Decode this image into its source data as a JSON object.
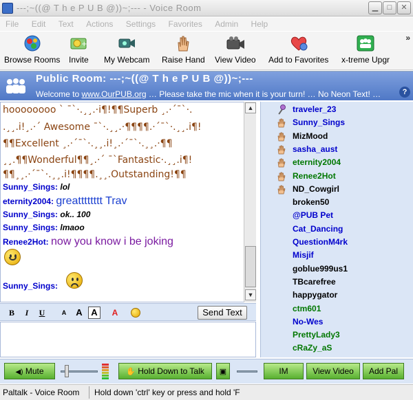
{
  "window": {
    "title": "---;~((@  T h e  P U B  @))~;--- - Voice Room"
  },
  "menu": [
    "File",
    "Edit",
    "Text",
    "Actions",
    "Settings",
    "Favorites",
    "Admin",
    "Help"
  ],
  "toolbar": {
    "items": [
      {
        "label": "Browse Rooms",
        "icon": "globe-icon"
      },
      {
        "label": "Invite",
        "icon": "invite-icon"
      },
      {
        "label": "My Webcam",
        "icon": "webcam-icon"
      },
      {
        "label": "Raise Hand",
        "icon": "hand-icon"
      },
      {
        "label": "View Video",
        "icon": "video-camera-icon"
      },
      {
        "label": "Add to Favorites",
        "icon": "heart-icon"
      },
      {
        "label": "x-treme Upgr",
        "icon": "group-icon"
      }
    ],
    "more": "»"
  },
  "room": {
    "title_prefix": "Public Room:",
    "title": "---;~((@  T h e  P U B  @))~;---",
    "welcome_prefix": "Welcome to",
    "welcome_link": "www.OurPUB.org",
    "welcome_rest": "… Please take the mic when it is your turn! … No Neon Text! …"
  },
  "chat": {
    "art_lines": [
      {
        "text": "hoooooooo ` ¯`·.¸¸.·i¶!¶¶Superb ¸.·´¯`·.",
        "color": "#8b4513"
      },
      {
        "text": ".¸¸.i!¸.·´ Awesome ¯`·.¸¸.·¶¶¶¶.·´¯`·.¸¸.i¶!",
        "color": "#8b4513"
      },
      {
        "text": "¶¶Excellent ¸.·´¯`·.¸¸.i!¸.·´¯`·.¸¸.·¶¶",
        "color": "#8b4513"
      },
      {
        "text": "¸¸.¶¶Wonderful¶¶¸.·´ ¯`Fantastic·.¸¸.i¶!",
        "color": "#8b4513"
      },
      {
        "text": "¶¶¸¸.·´¯`·.¸¸.i!¶¶¶¶.¸¸.Outstanding!¶¶",
        "color": "#8b4513"
      }
    ],
    "messages": [
      {
        "nick": "Sunny_Sings:",
        "text": "lol",
        "style": "italic",
        "color": "#000000"
      },
      {
        "nick": "eternity2004:",
        "text": "greatttttttt Trav",
        "style": "large",
        "color": "#1a3fd0"
      },
      {
        "nick": "Sunny_Sings:",
        "text": "ok.. 100",
        "style": "italic",
        "color": "#000000"
      },
      {
        "nick": "Sunny_Sings:",
        "text": "lmaoo",
        "style": "italic",
        "color": "#000000"
      },
      {
        "nick": "Renee2Hot:",
        "text": "now you know i be joking",
        "style": "large",
        "color": "#7a1aa0"
      },
      {
        "nick": "Sunny_Sings:",
        "text": "",
        "style": "emote",
        "color": "#000000"
      }
    ]
  },
  "format_bar": {
    "bold": "B",
    "italic": "I",
    "underline": "U",
    "font_small": "A",
    "font_large": "A",
    "font_normal": "A",
    "font_color": "A",
    "send_label": "Send Text"
  },
  "bottom": {
    "mute_label": "Mute",
    "talk_label": "Hold Down to Talk",
    "im_label": "IM",
    "view_video_label": "View Video",
    "add_pal_label": "Add Pal"
  },
  "status": {
    "app": "Paltalk - Voice Room",
    "hint": "Hold down 'ctrl' key or press and hold 'F"
  },
  "users": [
    {
      "name": "traveler_23",
      "color": "#0000cc",
      "icon": "microphone-icon"
    },
    {
      "name": "Sunny_Sings",
      "color": "#0000cc",
      "icon": "hand-icon"
    },
    {
      "name": "MizMood",
      "color": "#000000",
      "icon": "hand-icon"
    },
    {
      "name": "sasha_aust",
      "color": "#0000cc",
      "icon": "hand-icon"
    },
    {
      "name": "eternity2004",
      "color": "#007700",
      "icon": "hand-icon"
    },
    {
      "name": "Renee2Hot",
      "color": "#007700",
      "icon": "hand-icon"
    },
    {
      "name": "ND_Cowgirl",
      "color": "#000000",
      "icon": "hand-icon"
    },
    {
      "name": "broken50",
      "color": "#000000",
      "icon": ""
    },
    {
      "name": "@PUB Pet",
      "color": "#0000cc",
      "icon": ""
    },
    {
      "name": "Cat_Dancing",
      "color": "#0000cc",
      "icon": ""
    },
    {
      "name": "QuestionM4rk",
      "color": "#0000cc",
      "icon": ""
    },
    {
      "name": "Misjif",
      "color": "#0000cc",
      "icon": ""
    },
    {
      "name": "goblue999us1",
      "color": "#000000",
      "icon": ""
    },
    {
      "name": "TBcarefree",
      "color": "#000000",
      "icon": ""
    },
    {
      "name": "happygator",
      "color": "#000000",
      "icon": ""
    },
    {
      "name": "ctm601",
      "color": "#007700",
      "icon": ""
    },
    {
      "name": "No-Wes",
      "color": "#0000cc",
      "icon": ""
    },
    {
      "name": "PrettyLady3",
      "color": "#007700",
      "icon": ""
    },
    {
      "name": "cRaZy_aS",
      "color": "#007700",
      "icon": ""
    }
  ]
}
